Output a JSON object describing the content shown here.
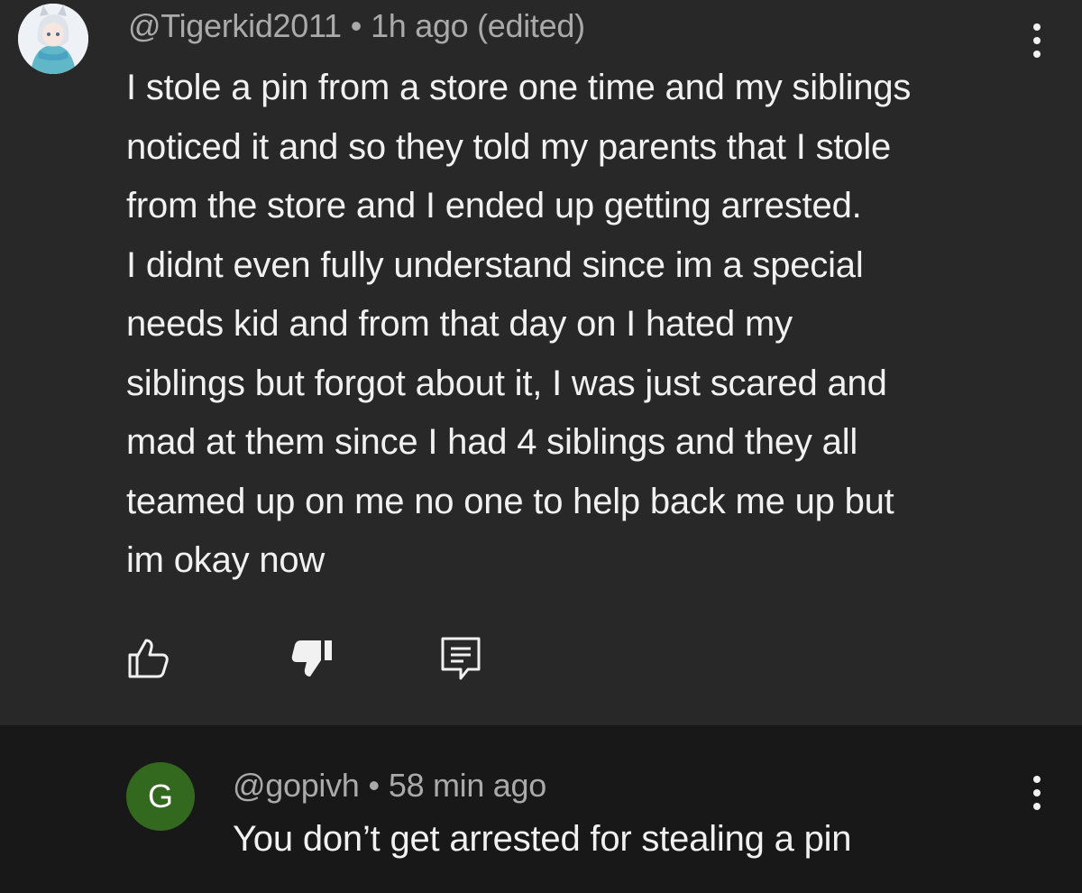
{
  "comment": {
    "author": "@Tigerkid2011",
    "separator": "•",
    "time": "1h ago (edited)",
    "lines": [
      "I stole a pin from a store one time and my siblings",
      "noticed it and so they told my parents that I stole",
      "from the store and I ended up getting arrested.",
      "I didnt even fully understand since im a special",
      "needs kid and from that day on I hated my",
      "siblings but forgot about it, I was just scared and",
      "mad at them since I had 4 siblings and they all",
      "teamed up on me no one to help back me up but",
      "im okay now"
    ],
    "actions": {
      "like_icon": "thumbs-up-icon",
      "dislike_icon": "thumbs-down-icon",
      "reply_icon": "reply-comment-icon"
    }
  },
  "reply": {
    "avatar_letter": "G",
    "avatar_color": "#33691e",
    "author": "@gopivh",
    "separator": "•",
    "time": "58 min ago",
    "text": "You don’t get arrested for stealing a pin"
  },
  "colors": {
    "background": "#282828",
    "reply_background": "#181818",
    "text": "#f1f1f1",
    "meta": "#aaaaaa"
  }
}
